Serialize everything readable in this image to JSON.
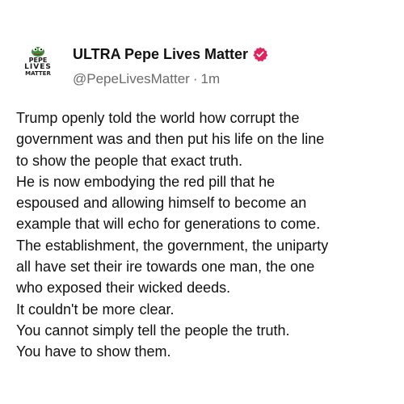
{
  "post": {
    "author": {
      "display_name": "ULTRA Pepe Lives Matter",
      "handle": "@PepeLivesMatter",
      "separator": "·",
      "time": "1m",
      "verified_icon": "verified-badge-icon",
      "avatar_text": [
        "PEPE",
        "LIVES",
        "MATTER"
      ],
      "verified_color": "#e0245e"
    },
    "body_lines": [
      "Trump openly told the world how corrupt the",
      "government was and then put his life on the line",
      "to show the people that exact truth.",
      "He is now embodying the red pill that he",
      "espoused and allowing himself to become an",
      "example that will echo for generations to come.",
      "The establishment, the government, the uniparty",
      "all have set their ire towards one man, the one",
      "who exposed their wicked deeds.",
      "It couldn't be more clear.",
      "You cannot simply tell the people the truth.",
      "You have to show them."
    ]
  }
}
